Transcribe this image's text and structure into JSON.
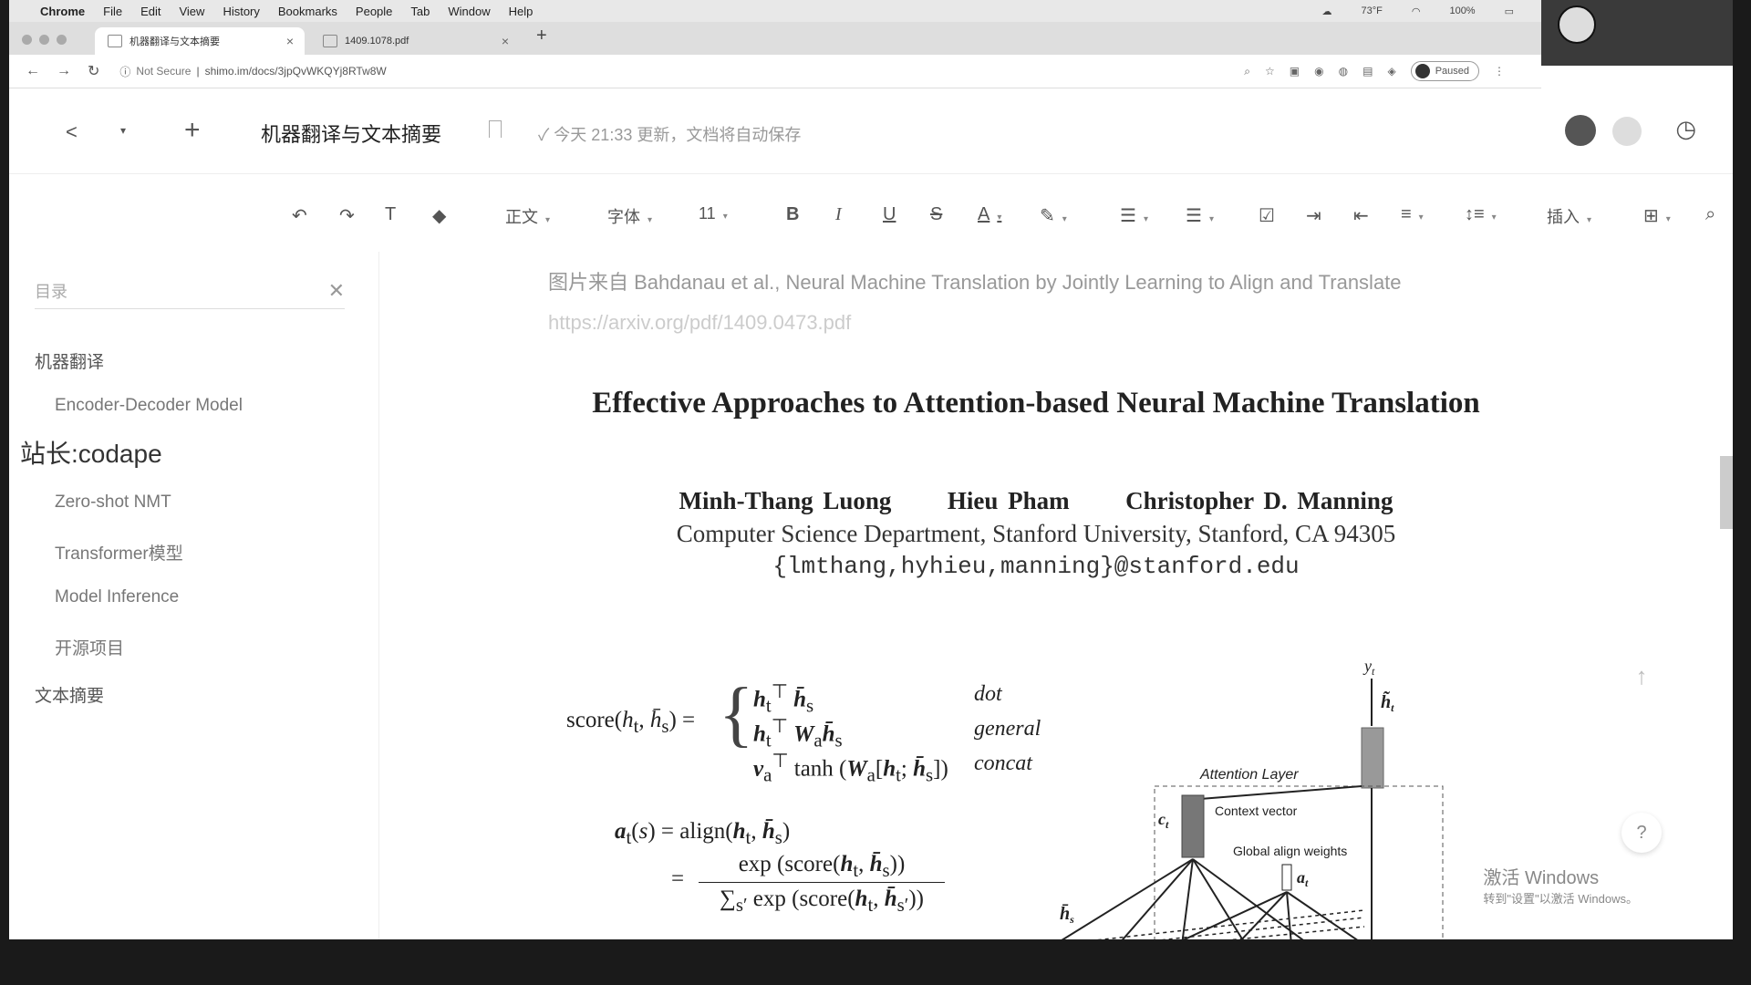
{
  "menubar": {
    "app": "Chrome",
    "items": [
      "File",
      "Edit",
      "View",
      "History",
      "Bookmarks",
      "People",
      "Tab",
      "Window",
      "Help"
    ],
    "right": [
      "73°F",
      "100%"
    ]
  },
  "tabs": [
    {
      "title": "机器翻译与文本摘要"
    },
    {
      "title": "1409.1078.pdf"
    }
  ],
  "address": {
    "security": "Not Secure",
    "url": "shimo.im/docs/3jpQvWKQYj8RTw8W",
    "profile_status": "Paused"
  },
  "doc_header": {
    "title": "机器翻译与文本摘要",
    "status": "今天 21:33 更新，文档将自动保存"
  },
  "toolbar": {
    "style": "正文",
    "font": "字体",
    "size": "11",
    "insert": "插入"
  },
  "sidebar": {
    "heading": "目录",
    "items": [
      {
        "label": "机器翻译"
      },
      {
        "label": "Encoder-Decoder Model"
      },
      {
        "label": "Zero-shot NMT"
      },
      {
        "label": "Transformer模型"
      },
      {
        "label": "Model Inference"
      },
      {
        "label": "开源项目"
      },
      {
        "label": "文本摘要"
      }
    ],
    "overlay": "站长:codape"
  },
  "document": {
    "caption": "图片来自 Bahdanau et al., Neural Machine Translation by Jointly Learning to Align and Translate ",
    "caption_link": "https://arxiv.org/pdf/1409.0473.pdf",
    "paper_title": "Effective Approaches to Attention-based Neural Machine Translation",
    "authors": [
      "Minh-Thang Luong",
      "Hieu Pham",
      "Christopher D. Manning"
    ],
    "affiliation": "Computer Science Department, Stanford University, Stanford, CA 94305",
    "email": "{lmthang,hyhieu,manning}@stanford.edu",
    "score_labels": [
      "dot",
      "general",
      "concat"
    ],
    "diagram": {
      "attention_layer": "Attention Layer",
      "context_vector": "Context vector",
      "global_align": "Global align weights"
    }
  },
  "os_watermark": {
    "line1": "激活 Windows",
    "line2": "转到\"设置\"以激活 Windows。"
  }
}
